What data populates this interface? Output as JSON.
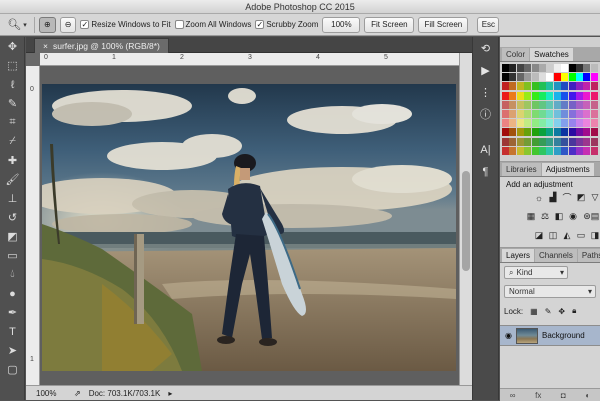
{
  "app": {
    "title": "Adobe Photoshop CC 2015"
  },
  "options": {
    "resize_windows_label": "Resize Windows to Fit",
    "zoom_all_label": "Zoom All Windows",
    "scrubby_zoom_label": "Scrubby Zoom",
    "zoom_value": "100%",
    "fit_screen_label": "Fit Screen",
    "fill_screen_label": "Fill Screen",
    "esc_label": "Esc"
  },
  "document": {
    "tab_label": "surfer.jpg @ 100% (RGB/8*)",
    "close_symbol": "×"
  },
  "ruler": {
    "h_labels": [
      "0",
      "1",
      "2",
      "3",
      "4",
      "5"
    ],
    "v_labels": [
      "0",
      "1"
    ]
  },
  "status": {
    "zoom": "100%",
    "doc_size": "Doc: 703.1K/703.1K"
  },
  "panels": {
    "color_tabs": [
      "Color",
      "Swatches"
    ],
    "adjust_tabs": [
      "Libraries",
      "Adjustments"
    ],
    "adjust_heading": "Add an adjustment",
    "layers_tabs": [
      "Layers",
      "Channels",
      "Paths"
    ],
    "kind_label": "Kind",
    "blend_mode": "Normal",
    "lock_label": "Lock:",
    "layer_name": "Background"
  },
  "colors": {
    "accent": "#a7b6cc",
    "panel_bg": "#d4d4d4",
    "canvas_bg": "#5f5f5f"
  },
  "icons": {
    "toolbar": [
      "move-icon",
      "marquee-icon",
      "lasso-icon",
      "quick-select-icon",
      "crop-icon",
      "eyedropper-icon",
      "healing-brush-icon",
      "brush-icon",
      "clone-stamp-icon",
      "history-brush-icon",
      "eraser-icon",
      "gradient-icon",
      "blur-icon",
      "dodge-icon",
      "pen-icon",
      "type-icon",
      "path-select-icon",
      "rectangle-icon"
    ]
  }
}
